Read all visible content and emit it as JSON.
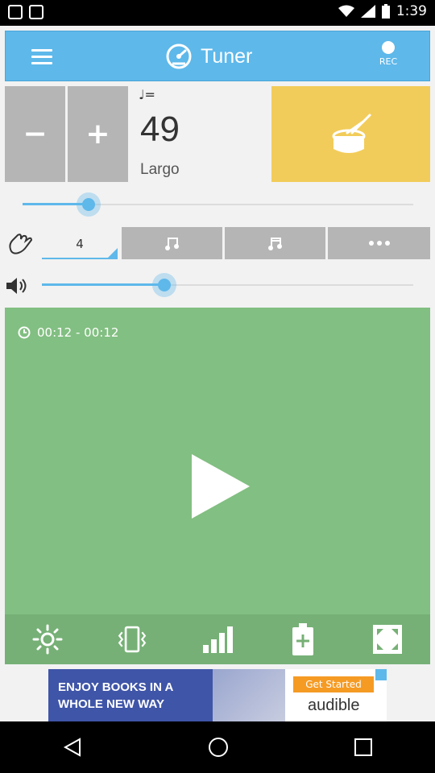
{
  "status_bar": {
    "time": "1:39"
  },
  "header": {
    "title": "Tuner",
    "rec_label": "REC"
  },
  "tempo": {
    "minus_label": "−",
    "plus_label": "+",
    "note_equals": "♩=",
    "bpm": "49",
    "name": "Largo"
  },
  "beat": {
    "count": "4",
    "tempo_slider_value": 0.17,
    "volume_slider_value": 0.33
  },
  "player": {
    "time_range": "00:12 - 00:12"
  },
  "ad": {
    "headline_line1": "ENJOY BOOKS IN A",
    "headline_line2": "WHOLE NEW WAY",
    "cta": "Get Started",
    "brand": "audible"
  },
  "colors": {
    "accent": "#5eb8ea",
    "drum": "#f2cc5a",
    "player": "#82bf82",
    "button_gray": "#b5b5b5"
  }
}
